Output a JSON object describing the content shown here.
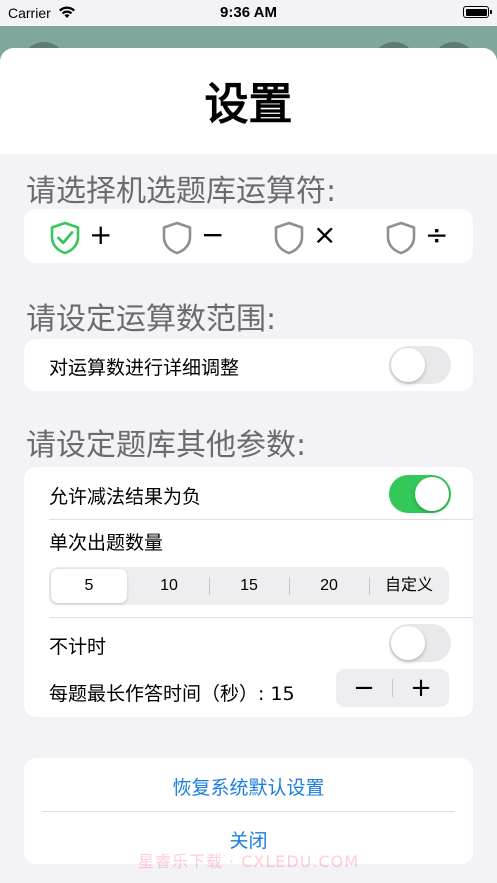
{
  "status_bar": {
    "carrier": "Carrier",
    "time": "9:36 AM"
  },
  "sheet": {
    "title": "设置",
    "sections": {
      "operators": {
        "title": "请选择机选题库运算符:",
        "items": [
          {
            "symbol": "+",
            "selected": true,
            "icon": "shield-checkmark-icon"
          },
          {
            "symbol": "−",
            "selected": false,
            "icon": "shield-icon"
          },
          {
            "symbol": "×",
            "selected": false,
            "icon": "shield-icon"
          },
          {
            "symbol": "÷",
            "selected": false,
            "icon": "shield-icon"
          }
        ]
      },
      "range": {
        "title": "请设定运算数范围:",
        "detail_label": "对运算数进行详细调整",
        "detail_on": false
      },
      "other": {
        "title": "请设定题库其他参数:",
        "allow_negative_label": "允许减法结果为负",
        "allow_negative_on": true,
        "count_label": "单次出题数量",
        "count_options": [
          "5",
          "10",
          "15",
          "20",
          "自定义"
        ],
        "count_selected": "5",
        "no_timer_label": "不计时",
        "no_timer_on": false,
        "max_time_label": "每题最长作答时间（秒）: 15",
        "stepper_minus": "−",
        "stepper_plus": "+"
      }
    },
    "actions": {
      "restore": "恢复系统默认设置",
      "close": "关闭"
    },
    "watermark": "星睿乐下载 · CXLEDU.COM"
  },
  "colors": {
    "accent": "#1a7ee0",
    "toggle_on": "#34c759",
    "selected_check": "#34c759",
    "section_title": "#6b6b6f",
    "background": "#f2f2f7"
  }
}
